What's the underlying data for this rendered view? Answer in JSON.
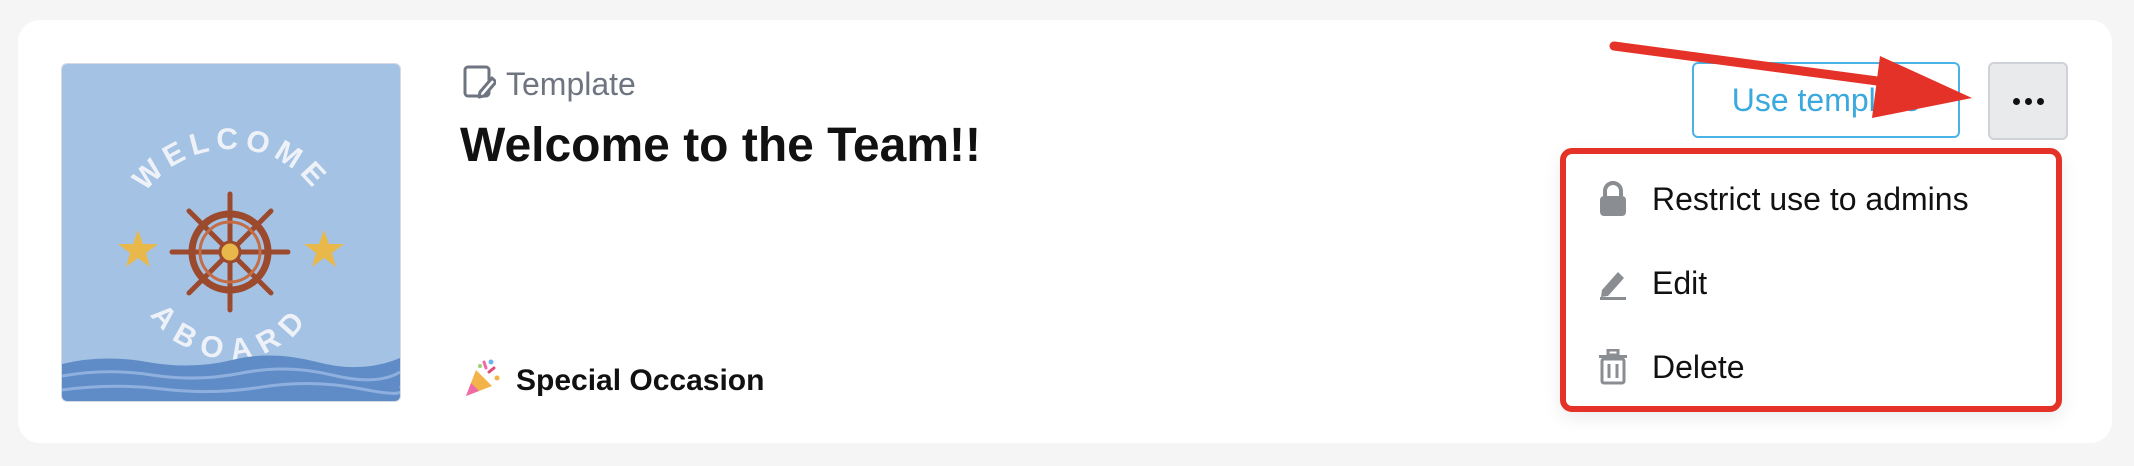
{
  "template_card": {
    "type_label": "Template",
    "title": "Welcome to the Team!!",
    "thumbnail": {
      "alt_text": "WELCOME ABOARD",
      "top_text": "WELCOME",
      "bottom_text": "ABOARD",
      "background": "#a4c2e4",
      "wave_color": "#5f8cc7",
      "wheel_color": "#9b4a2e",
      "star_color": "#e9b84b"
    },
    "category": {
      "icon": "party-popper-icon",
      "label": "Special Occasion"
    },
    "actions": {
      "use_template_label": "Use template",
      "more_icon": "more-dots-icon"
    },
    "dropdown_menu": {
      "items": [
        {
          "label": "Restrict use to admins",
          "icon": "lock-icon"
        },
        {
          "label": "Edit",
          "icon": "pencil-icon"
        },
        {
          "label": "Delete",
          "icon": "trash-icon"
        }
      ]
    }
  },
  "annotations": {
    "highlight_color": "#e53228"
  }
}
